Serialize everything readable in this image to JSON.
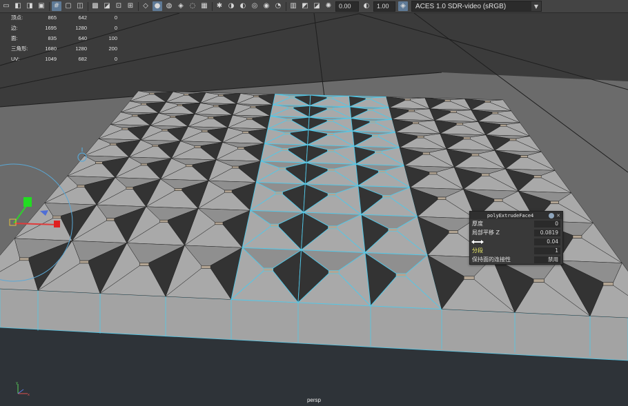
{
  "toolbar": {
    "icons_left": [
      "camera-icon",
      "bookmark-icon",
      "camera-attributes-icon",
      "image-plane-icon",
      "grid-icon",
      "film-gate-icon",
      "resolution-gate-icon",
      "gate-mask-icon",
      "field-chart-icon",
      "safe-action-icon",
      "safe-title-icon"
    ],
    "icons_shading": [
      "wireframe-icon",
      "smooth-shade-icon",
      "use-default-material-icon",
      "wireframe-on-shaded-icon",
      "xray-icon",
      "textured-icon",
      "lighting-icon",
      "shadows-icon",
      "screen-space-ao-icon",
      "motion-blur-icon",
      "multisample-aa-icon",
      "depth-of-field-icon",
      "isolate-select-icon",
      "xray-joints-icon",
      "xray-active-icon",
      "exposure-icon"
    ],
    "exposure_value": "0.00",
    "gamma_value": "1.00",
    "colorspace": "ACES 1.0 SDR-video (sRGB)"
  },
  "hud": {
    "rows": [
      {
        "label": "顶点:",
        "v1": "865",
        "v2": "642",
        "v3": "0"
      },
      {
        "label": "边:",
        "v1": "1695",
        "v2": "1280",
        "v3": "0"
      },
      {
        "label": "面:",
        "v1": "835",
        "v2": "640",
        "v3": "100"
      },
      {
        "label": "三角形:",
        "v1": "1680",
        "v2": "1280",
        "v3": "200"
      },
      {
        "label": "UV:",
        "v1": "1049",
        "v2": "682",
        "v3": "0"
      }
    ]
  },
  "channel_box": {
    "title": "polyExtrudeFace4",
    "rows": [
      {
        "label": "厚度",
        "value": "0",
        "highlight": false
      },
      {
        "label": "局部平移 Z",
        "value": "0.0819",
        "highlight": false
      },
      {
        "label": "",
        "value": "0.04",
        "highlight": false
      },
      {
        "label": "分段",
        "value": "1",
        "highlight": true
      },
      {
        "label": "保持面的连接性",
        "value": "禁用",
        "highlight": false
      }
    ]
  },
  "viewport": {
    "camera_label": "persp"
  },
  "colors": {
    "selection_edge": "#52c8e8",
    "face_light": "#a9a9a9",
    "face_dark": "#333333",
    "ground": "#6b6b6b"
  }
}
